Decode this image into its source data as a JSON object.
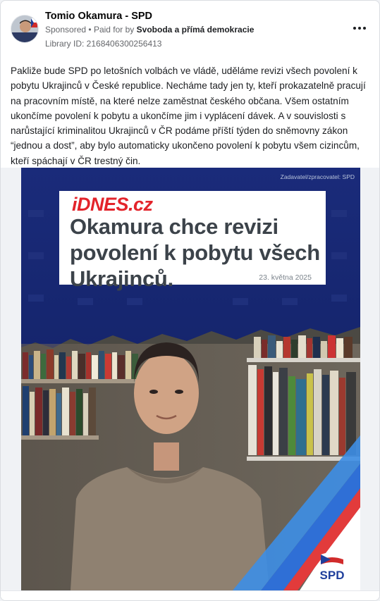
{
  "post": {
    "page_name": "Tomio Okamura - SPD",
    "sponsored_label": "Sponsored",
    "separator": "•",
    "paid_for_prefix": "Paid for by",
    "payer": "Svoboda a přímá demokracie",
    "library_id": "Library ID: 2168406300256413",
    "more_icon": "more-horizontal-icon",
    "text": "Pakliže bude SPD po letošních volbách ve vládě, uděláme revizi všech povolení k pobytu Ukrajinců v České republice. Necháme tady jen ty, kteří prokazatelně pracují na pracovním místě, na které nelze zaměstnat českého občana. Všem ostatním ukončíme povolení k pobytu a ukončíme jim i vyplácení dávek. A v souvislosti s narůstající kriminalitou Ukrajinců v ČR podáme příští týden do sněmovny zákon “jednou a dost”, aby bylo automaticky ukončeno povolení k pobytu všem cizincům, kteří spáchají v ČR trestný čin."
  },
  "creative": {
    "sponsor_note": "Zadavatel/zpracovatel: SPD",
    "logo": "iDNES.cz",
    "headline": "Okamura chce revizi povolení k pobytu všech Ukrajinců.",
    "date": "23. května 2025",
    "party_logo": "SPD",
    "colors": {
      "background": "#14246f",
      "logo_red": "#e3242b",
      "brand_blue": "#1f3f9c"
    }
  }
}
